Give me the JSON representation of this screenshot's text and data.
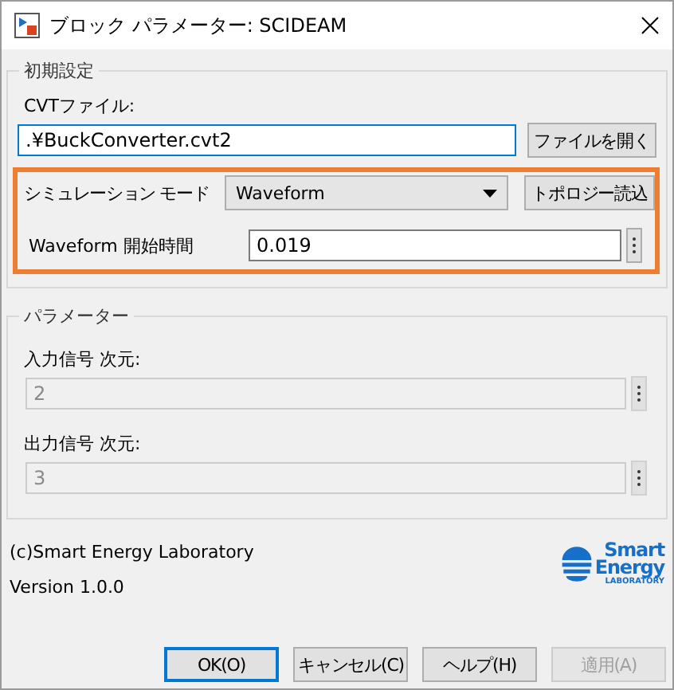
{
  "window": {
    "title": "ブロック パラメーター: SCIDEAM"
  },
  "initial_settings": {
    "title": "初期設定",
    "cvt_label": "CVTファイル:",
    "cvt_value": ".¥BuckConverter.cvt2",
    "cvt_focused": true,
    "open_button": "ファイルを開く",
    "highlighted": true,
    "mode_label": "シミュレーション モード",
    "mode_value": "Waveform",
    "topology_button": "トポロジー読込",
    "start_label": "Waveform 開始時間",
    "start_value": "0.019"
  },
  "parameters": {
    "title": "パラメーター",
    "fields": [
      {
        "label": "入力信号 次元:",
        "value": "2",
        "disabled": true
      },
      {
        "label": "出力信号 次元:",
        "value": "3",
        "disabled": true
      }
    ]
  },
  "footer": {
    "copyright": "(c)Smart Energy Laboratory",
    "version": "Version 1.0.0",
    "logo_lines": [
      "Smart",
      "Energy",
      "LABORATORY"
    ]
  },
  "buttons": [
    {
      "label": "OK(O)",
      "default": true,
      "disabled": false
    },
    {
      "label": "キャンセル(C)",
      "default": false,
      "disabled": false
    },
    {
      "label": "ヘルプ(H)",
      "default": false,
      "disabled": false
    },
    {
      "label": "適用(A)",
      "default": false,
      "disabled": true
    }
  ]
}
